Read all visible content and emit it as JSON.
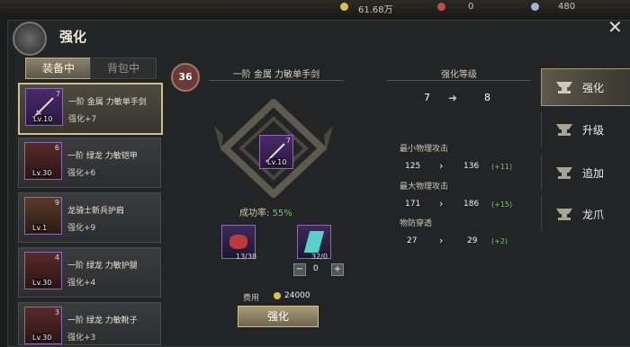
{
  "topbar": {
    "currency1": "61.68万",
    "currency2": "0",
    "currency3": "480"
  },
  "header": {
    "title": "强化"
  },
  "tabs": {
    "equipped": "装备中",
    "bag": "背包中"
  },
  "items": [
    {
      "name": "一阶 金属 力敏单手剑",
      "bonus": "强化+7",
      "level": "Lv.10",
      "top": "7"
    },
    {
      "name": "一阶 绿龙 力敏铠甲",
      "bonus": "强化+6",
      "level": "Lv.30",
      "top": "6"
    },
    {
      "name": "龙骑士新兵护肩",
      "bonus": "强化+9",
      "level": "Lv.1",
      "top": "9"
    },
    {
      "name": "一阶 绿龙 力敏护腿",
      "bonus": "强化+4",
      "level": "Lv.30",
      "top": "4"
    },
    {
      "name": "一阶 绿龙 力敏靴子",
      "bonus": "强化+3",
      "level": "Lv.30",
      "top": "3"
    }
  ],
  "center": {
    "rank": "36",
    "weapon_name": "一阶 金属 力敏单手剑",
    "weapon_level": "Lv.10",
    "weapon_top": "7",
    "success_label": "成功率:",
    "success_value": "55%",
    "mat1_count": "13/38",
    "mat2_count": "32/0",
    "quantity": "0",
    "fee_label": "费用",
    "fee_value": "24000",
    "button": "强化"
  },
  "enhance": {
    "header": "强化等级",
    "from": "7",
    "to": "8",
    "stats": [
      {
        "label": "最小物理攻击",
        "from": "125",
        "to": "136",
        "inc": "(+11)"
      },
      {
        "label": "最大物理攻击",
        "from": "171",
        "to": "186",
        "inc": "(+15)"
      },
      {
        "label": "物防穿透",
        "from": "27",
        "to": "29",
        "inc": "(+2)"
      }
    ]
  },
  "sidebar": [
    {
      "label": "强化"
    },
    {
      "label": "升级"
    },
    {
      "label": "追加"
    },
    {
      "label": "龙爪"
    }
  ]
}
